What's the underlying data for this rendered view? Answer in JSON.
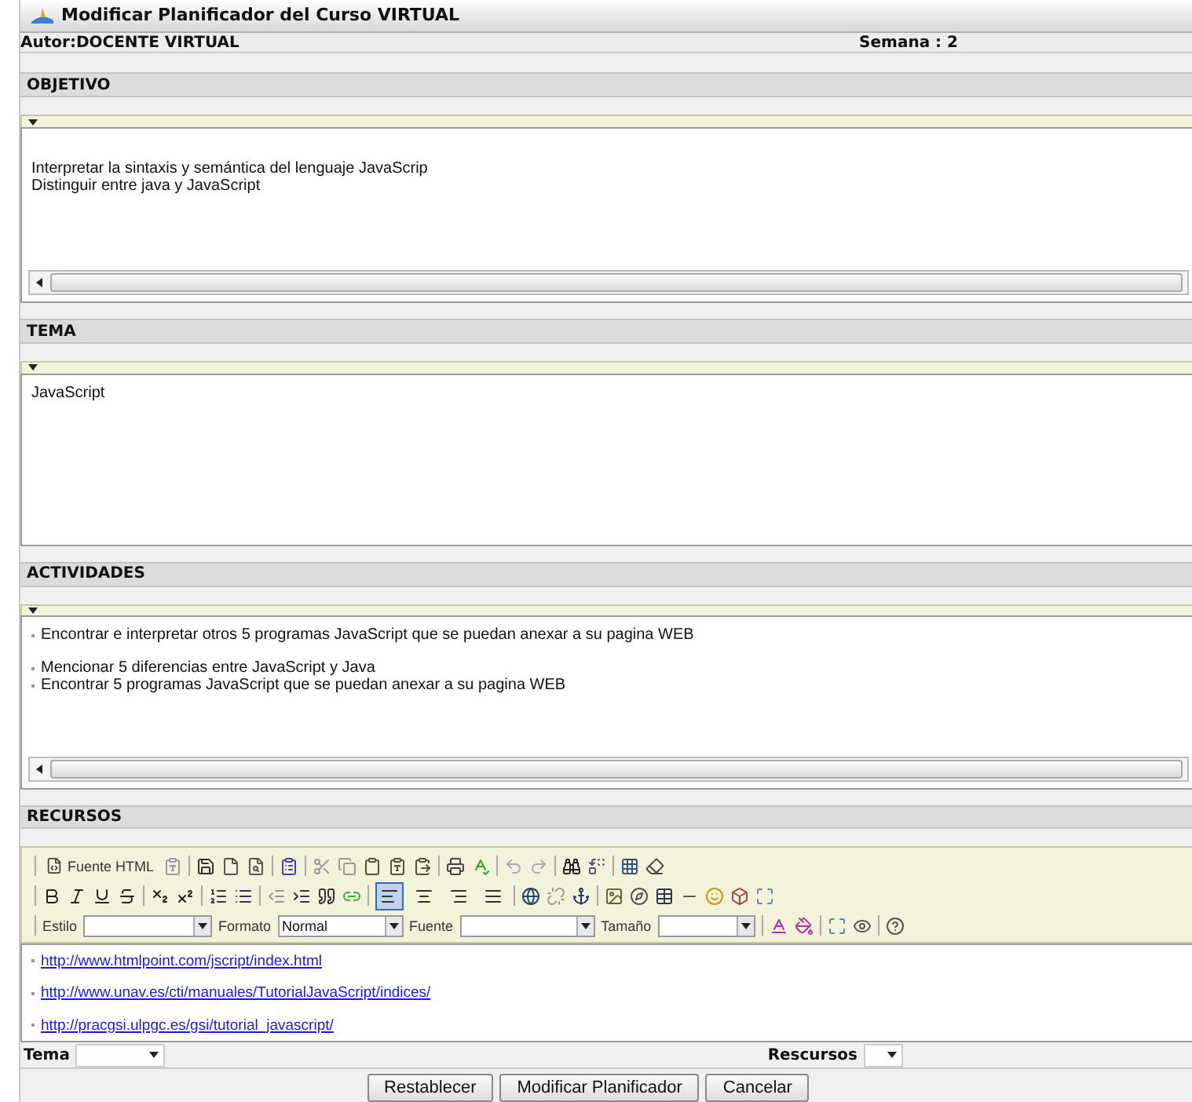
{
  "window": {
    "title": "Modificar Planificador del Curso VIRTUAL"
  },
  "header": {
    "author": "Autor:DOCENTE VIRTUAL",
    "week": "Semana : 2"
  },
  "sections": [
    {
      "kind": "text",
      "title": "OBJETIVO",
      "scrollbar": true,
      "paragraphs": [
        [
          "Interpretar la sintaxis y semántica del lenguaje JavaScrip",
          "Distinguir entre java y JavaScript"
        ]
      ]
    },
    {
      "kind": "text",
      "title": "TEMA",
      "scrollbar": false,
      "paragraphs": [
        [
          "JavaScript"
        ]
      ]
    },
    {
      "kind": "text",
      "title": "ACTIVIDADES",
      "scrollbar": true,
      "paragraphs": [
        [
          "Encontrar e interpretar otros 5 programas JavaScript que se puedan anexar a su pagina WEB"
        ],
        [
          "Mencionar  5 diferencias entre JavaScript y Java",
          "Encontrar 5 programas JavaScript que se puedan anexar a su pagina WEB"
        ]
      ]
    },
    {
      "kind": "rich",
      "title": "RECURSOS",
      "links": [
        "http://www.htmlpoint.com/jscript/index.html",
        "http://www.unav.es/cti/manuales/TutorialJavaScript/indices/",
        "http://pracgsi.ulpgc.es/gsi/tutorial_javascript/"
      ]
    }
  ],
  "toolbar": {
    "source_button": "Fuente HTML",
    "align_buttons": [
      {
        "selected": true
      },
      {
        "selected": false
      },
      {
        "selected": false
      },
      {
        "selected": false
      }
    ],
    "dropdowns": [
      {
        "label": "Estilo"
      },
      {
        "label": "Formato",
        "value": "Normal"
      },
      {
        "label": "Fuente"
      },
      {
        "label": "Tamaño"
      }
    ]
  },
  "footer": {
    "fields": [
      {
        "label": "Tema"
      },
      {
        "label": "Rescursos"
      }
    ],
    "buttons": [
      "Restablecer",
      "Modificar Planificador",
      "Cancelar"
    ]
  }
}
